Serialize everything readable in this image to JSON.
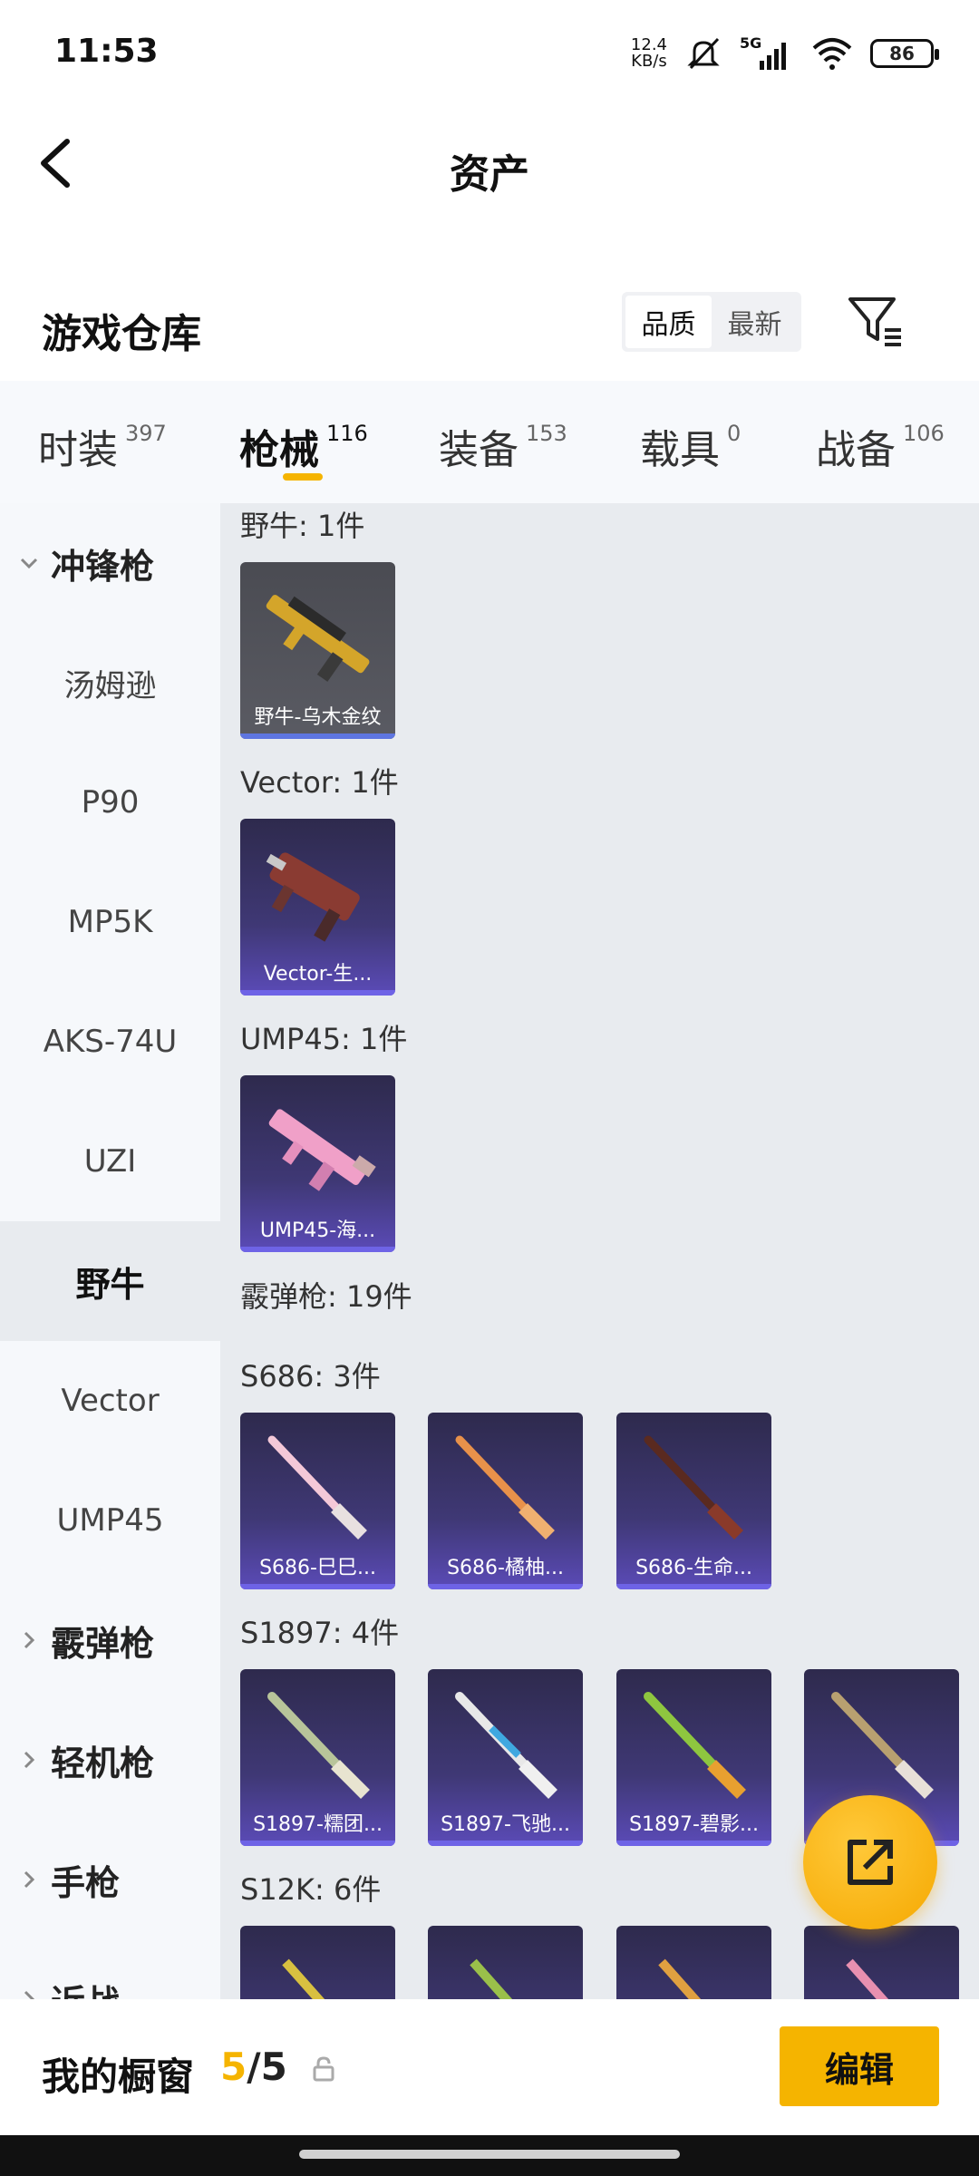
{
  "status": {
    "time": "11:53",
    "net_speed_value": "12.4",
    "net_speed_unit": "KB/s",
    "network": "5G",
    "battery": "86"
  },
  "header": {
    "title": "资产"
  },
  "warehouse": {
    "title": "游戏仓库",
    "sort_options": [
      "品质",
      "最新"
    ],
    "active_sort": "品质"
  },
  "tabs": [
    {
      "label": "时装",
      "count": "397"
    },
    {
      "label": "枪械",
      "count": "116"
    },
    {
      "label": "装备",
      "count": "153"
    },
    {
      "label": "载具",
      "count": "0"
    },
    {
      "label": "战备",
      "count": "106"
    }
  ],
  "active_tab": "枪械",
  "sidebar": {
    "items": [
      {
        "label": "冲锋枪",
        "type": "group",
        "expanded": true
      },
      {
        "label": "汤姆逊",
        "type": "sub"
      },
      {
        "label": "P90",
        "type": "sub"
      },
      {
        "label": "MP5K",
        "type": "sub"
      },
      {
        "label": "AKS-74U",
        "type": "sub"
      },
      {
        "label": "UZI",
        "type": "sub"
      },
      {
        "label": "野牛",
        "type": "sub",
        "selected": true
      },
      {
        "label": "Vector",
        "type": "sub"
      },
      {
        "label": "UMP45",
        "type": "sub"
      },
      {
        "label": "霰弹枪",
        "type": "group",
        "expanded": false
      },
      {
        "label": "轻机枪",
        "type": "group",
        "expanded": false
      },
      {
        "label": "手枪",
        "type": "group",
        "expanded": false
      },
      {
        "label": "近战",
        "type": "group",
        "expanded": false
      }
    ]
  },
  "content": {
    "groups": [
      {
        "label": "野牛: 1件",
        "cards": [
          "野牛-乌木金纹"
        ]
      },
      {
        "label": "Vector: 1件",
        "cards": [
          "Vector-生..."
        ]
      },
      {
        "label": "UMP45: 1件",
        "cards": [
          "UMP45-海..."
        ]
      },
      {
        "label": "霰弹枪: 19件",
        "cards": []
      },
      {
        "label": "S686: 3件",
        "cards": [
          "S686-巳巳...",
          "S686-橘柚...",
          "S686-生命..."
        ]
      },
      {
        "label": "S1897: 4件",
        "cards": [
          "S1897-糯团...",
          "S1897-飞驰...",
          "S1897-碧影...",
          "..."
        ]
      },
      {
        "label": "S12K: 6件",
        "cards": [
          "",
          "",
          "",
          ""
        ]
      }
    ]
  },
  "bottom": {
    "showcase_label": "我的橱窗",
    "showcase_current": "5",
    "showcase_total": "/5",
    "edit_label": "编辑"
  },
  "colors": {
    "accent": "#f5b400",
    "card_purple": "#3f3875",
    "card_gray": "#55565e"
  }
}
